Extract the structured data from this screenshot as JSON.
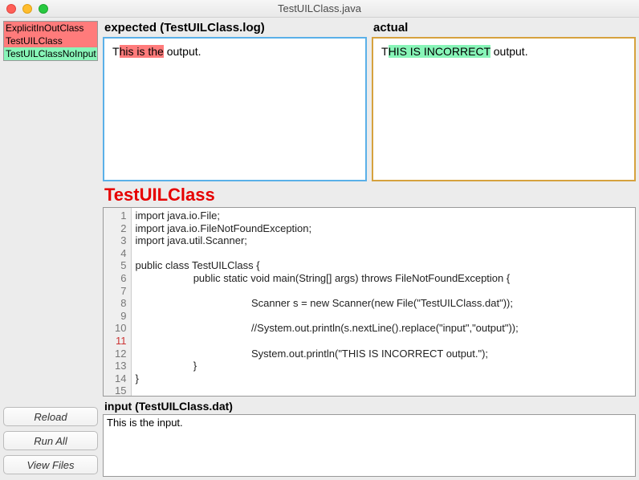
{
  "window": {
    "title": "TestUILClass.java"
  },
  "sidebar": {
    "items": [
      {
        "label": "ExplicitInOutClass",
        "status": "fail"
      },
      {
        "label": "TestUILClass",
        "status": "fail"
      },
      {
        "label": "TestUILClassNoInput",
        "status": "pass"
      }
    ],
    "buttons": {
      "reload": "Reload",
      "runall": "Run All",
      "viewfiles": "View Files"
    }
  },
  "expected": {
    "title": "expected (TestUILClass.log)",
    "prefix": "T",
    "highlight": "his is the",
    "suffix": " output."
  },
  "actual": {
    "title": "actual",
    "prefix": "T",
    "highlight": "HIS IS INCORRECT",
    "suffix": " output."
  },
  "classTitle": "TestUILClass",
  "code": {
    "lines": [
      "import java.io.File;",
      "import java.io.FileNotFoundException;",
      "import java.util.Scanner;",
      "",
      "public class TestUILClass {",
      "                    public static void main(String[] args) throws FileNotFoundException {",
      "",
      "                                        Scanner s = new Scanner(new File(\"TestUILClass.dat\"));",
      "",
      "                                        //System.out.println(s.nextLine().replace(\"input\",\"output\"));",
      "",
      "                                        System.out.println(\"THIS IS INCORRECT output.\");",
      "                    }",
      "}",
      ""
    ],
    "redLines": [
      11
    ]
  },
  "input": {
    "title": "input (TestUILClass.dat)",
    "text": "This is the input."
  }
}
